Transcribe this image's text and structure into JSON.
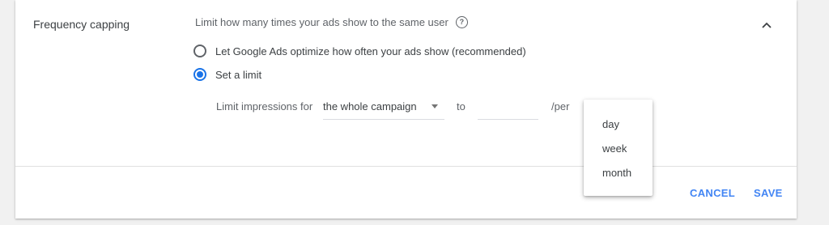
{
  "section": {
    "title": "Frequency capping",
    "description": "Limit how many times your ads show to the same user",
    "help_icon": "?"
  },
  "options": [
    {
      "label": "Let Google Ads optimize how often your ads show (recommended)",
      "selected": false
    },
    {
      "label": "Set a limit",
      "selected": true
    }
  ],
  "limit": {
    "label": "Limit impressions for",
    "scope_value": "the whole campaign",
    "to_label": "to",
    "count_value": "",
    "per_label": "/per"
  },
  "period_menu": {
    "items": [
      "day",
      "week",
      "month"
    ]
  },
  "actions": {
    "cancel": "CANCEL",
    "save": "SAVE"
  },
  "colors": {
    "accent": "#1a73e8",
    "button_text": "#4285f4"
  }
}
